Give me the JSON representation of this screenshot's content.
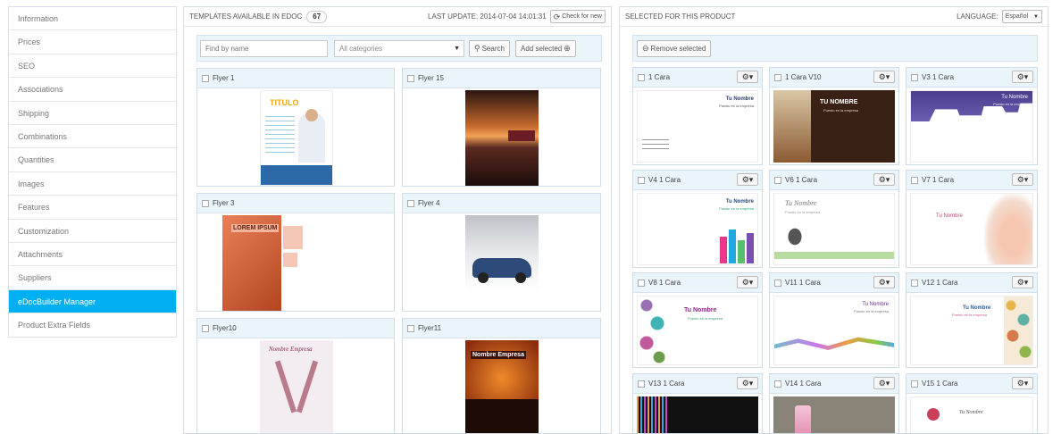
{
  "sidebar": {
    "items": [
      {
        "label": "Information"
      },
      {
        "label": "Prices"
      },
      {
        "label": "SEO"
      },
      {
        "label": "Associations"
      },
      {
        "label": "Shipping"
      },
      {
        "label": "Combinations"
      },
      {
        "label": "Quantities"
      },
      {
        "label": "Images"
      },
      {
        "label": "Features"
      },
      {
        "label": "Customization"
      },
      {
        "label": "Attachments"
      },
      {
        "label": "Suppliers"
      },
      {
        "label": "eDocBuilder Manager",
        "active": true
      },
      {
        "label": "Product Extra Fields"
      }
    ]
  },
  "templates": {
    "title": "TEMPLATES AVAILABLE IN EDOC",
    "count": "67",
    "last_update": "LAST UPDATE: 2014-07-04 14:01:31",
    "check_button": "Check for new",
    "search_placeholder": "Find by name",
    "category_select": "All categories",
    "search_button": "Search",
    "add_button": "Add selected",
    "cards": [
      {
        "title": "Flyer 1",
        "thumb_text": "TITULO"
      },
      {
        "title": "Flyer 15",
        "thumb_text": ""
      },
      {
        "title": "Flyer 3",
        "thumb_text": "LOREM IPSUM"
      },
      {
        "title": "Flyer 4",
        "thumb_text": ""
      },
      {
        "title": "Flyer10",
        "thumb_text": "Nombre Empresa"
      },
      {
        "title": "Flyer11",
        "thumb_text": "Nombre Empresa"
      }
    ]
  },
  "selected": {
    "title": "SELECTED FOR THIS PRODUCT",
    "language_label": "LANGUAGE:",
    "language_value": "Español",
    "remove_button": "Remove selected",
    "cards": [
      {
        "title": "1 Cara",
        "name": "Tu Nombre",
        "sub": "Puesto en la empresa"
      },
      {
        "title": "1 Cara V10",
        "name": "TU NOMBRE",
        "sub": "Puesto en la empresa"
      },
      {
        "title": "V3 1 Cara",
        "name": "Tu Nombre",
        "sub": "Puesto en la empresa"
      },
      {
        "title": "V4 1 Cara",
        "name": "Tu Nombre",
        "sub": "Puesto en la empresa"
      },
      {
        "title": "V6 1 Cara",
        "name": "Tu Nombre",
        "sub": "Puesto en la empresa"
      },
      {
        "title": "V7 1 Cara",
        "name": "Tu Nombre",
        "sub": ""
      },
      {
        "title": "V8 1 Cara",
        "name": "Tu Nombre",
        "sub": "Puesto en la empresa"
      },
      {
        "title": "V11 1 Cara",
        "name": "Tu Nombre",
        "sub": "Puesto en la empresa"
      },
      {
        "title": "V12 1 Cara",
        "name": "Tu Nombre",
        "sub": "Puesto en la empresa"
      },
      {
        "title": "V13 1 Cara",
        "name": "",
        "sub": ""
      },
      {
        "title": "V14 1 Cara",
        "name": "",
        "sub": ""
      },
      {
        "title": "V15 1 Cara",
        "name": "Tu Nombre",
        "sub": ""
      }
    ]
  },
  "colors": {
    "accent": "#00aff0",
    "card_header": "#eaf4fb"
  }
}
